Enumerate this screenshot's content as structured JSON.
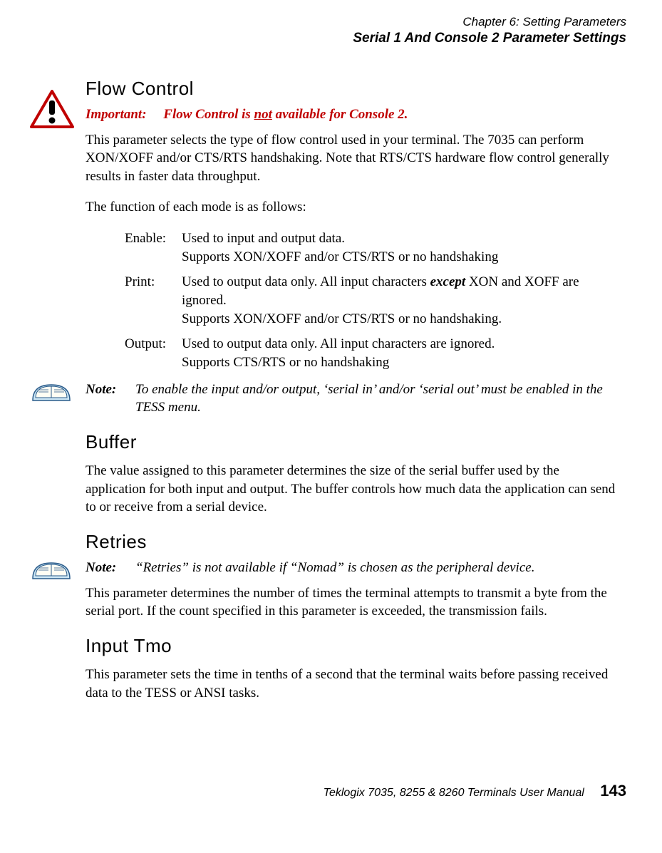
{
  "header": {
    "chapter": "Chapter  6:  Setting Parameters",
    "section": "Serial 1 And Console 2 Parameter Settings"
  },
  "flow": {
    "heading": "Flow Control",
    "important_label": "Important:",
    "important_pre": "Flow Control is ",
    "important_not": "not",
    "important_post": " available for Console 2.",
    "para1": "This parameter selects the type of flow control used in your terminal. The 7035 can perform XON/XOFF and/or CTS/RTS handshaking. Note that RTS/CTS hardware flow control generally results in faster data throughput.",
    "para2": "The function of each mode is as follows:",
    "modes": [
      {
        "label": "Enable:",
        "l1": "Used to input and output data.",
        "l2": "Supports XON/XOFF and/or CTS/RTS or no handshaking"
      },
      {
        "label": "Print:",
        "l1a": "Used to output data only. All input characters ",
        "l1b": "except",
        "l1c": " XON and XOFF are ignored.",
        "l2": "Supports XON/XOFF and/or CTS/RTS or no handshaking."
      },
      {
        "label": "Output:",
        "l1": "Used to output data only. All input characters are ignored.",
        "l2": "Supports CTS/RTS or no handshaking"
      }
    ],
    "note_label": "Note:",
    "note_text": "To enable the input and/or output, ‘serial in’ and/or ‘serial out’ must be enabled in the TESS menu."
  },
  "buffer": {
    "heading": "Buffer",
    "para": "The value assigned to this parameter determines the size of the serial buffer used by the application for both input and output. The buffer controls how much data the application can send to or receive from a serial device."
  },
  "retries": {
    "heading": "Retries",
    "note_label": "Note:",
    "note_text": "“Retries” is not available if “Nomad” is chosen as the peripheral device.",
    "para": "This parameter determines the number of times the terminal attempts to transmit a byte from the serial port. If the count specified in this parameter is exceeded, the transmission fails."
  },
  "input": {
    "heading": "Input Tmo",
    "para": "This parameter sets the time in tenths of a second that the terminal waits before passing received data to the TESS or ANSI tasks."
  },
  "footer": {
    "manual": "Teklogix 7035, 8255 & 8260 Terminals User Manual",
    "page": "143"
  }
}
